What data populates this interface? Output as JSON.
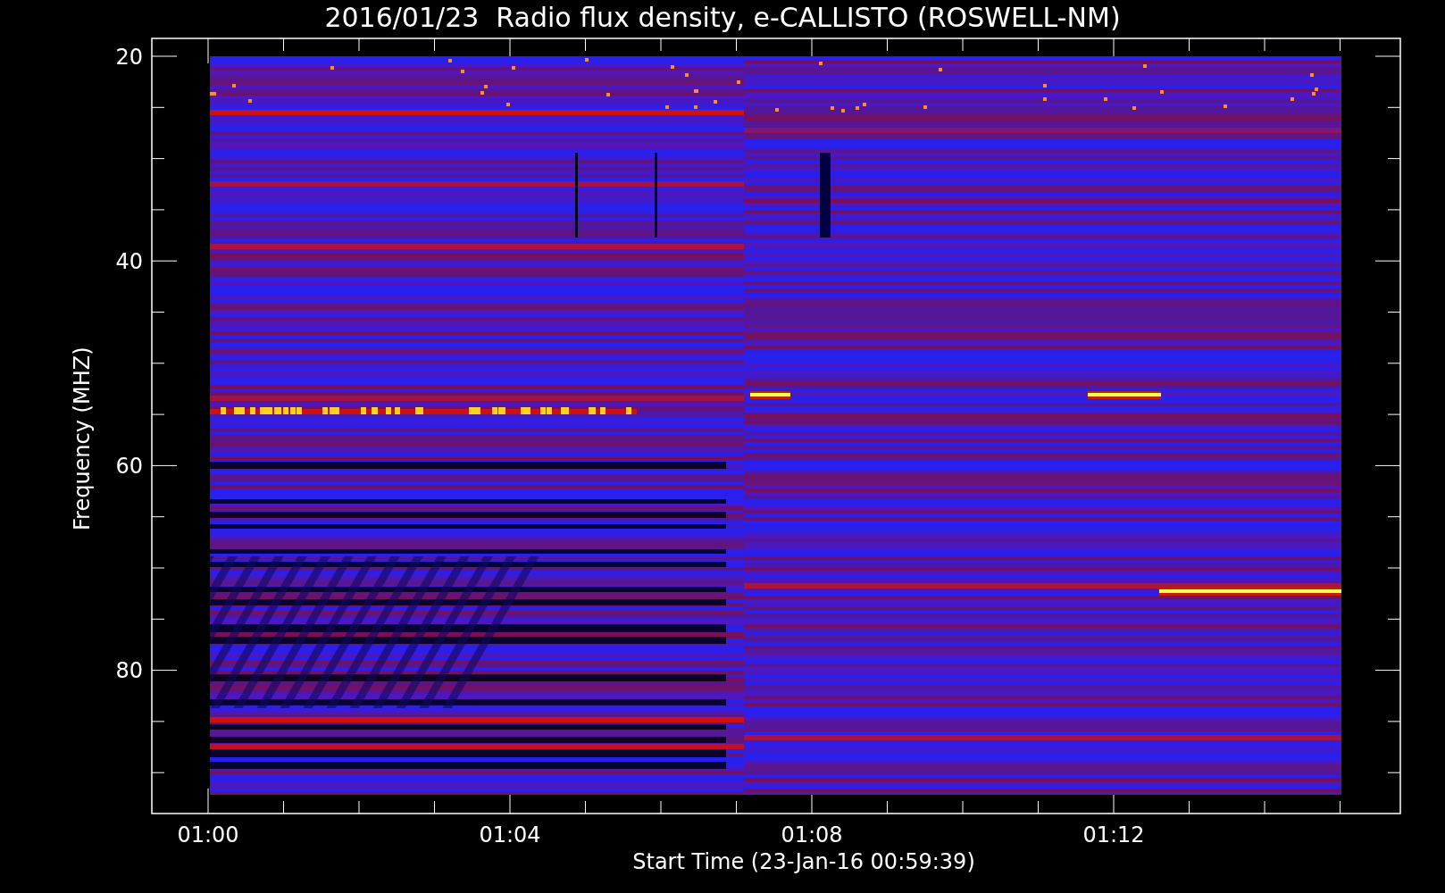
{
  "title": "2016/01/23  Radio flux density, e-CALLISTO (ROSWELL-NM)",
  "y_axis": {
    "label": "Frequency (MHZ)",
    "ticks": [
      "20",
      "40",
      "60",
      "80"
    ]
  },
  "x_axis": {
    "label": "Start Time (23-Jan-16 00:59:39)",
    "ticks": [
      "01:00",
      "01:04",
      "01:08",
      "01:12"
    ]
  }
}
